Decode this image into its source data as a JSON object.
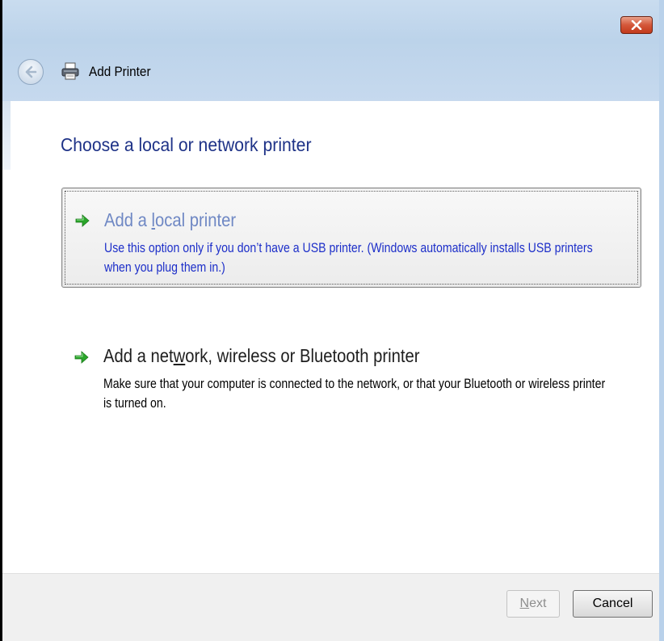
{
  "window": {
    "title": "Add Printer",
    "close_label": "Close"
  },
  "page": {
    "heading": "Choose a local or network printer"
  },
  "options": [
    {
      "title_pre": "Add a ",
      "title_mnemonic": "l",
      "title_post": "ocal printer",
      "description": "Use this option only if you don’t have a USB printer. (Windows automatically installs USB printers when you plug them in.)",
      "selected": true
    },
    {
      "title_pre": "Add a net",
      "title_mnemonic": "w",
      "title_post": "ork, wireless or Bluetooth printer",
      "description": "Make sure that your computer is connected to the network, or that your Bluetooth or wireless printer is turned on.",
      "selected": false
    }
  ],
  "buttons": {
    "next_mnemonic": "N",
    "next_rest": "ext",
    "next_enabled": false,
    "cancel": "Cancel"
  },
  "icons": {
    "back": "back-arrow-icon",
    "printer": "printer-icon",
    "option_arrow": "green-arrow-icon",
    "close": "close-x-icon"
  },
  "colors": {
    "heading": "#1e3287",
    "selected_title": "#6f88c4",
    "selected_desc": "#1d2fc9",
    "arrow_green": "#2aa52a",
    "close_red": "#c23a1b"
  }
}
